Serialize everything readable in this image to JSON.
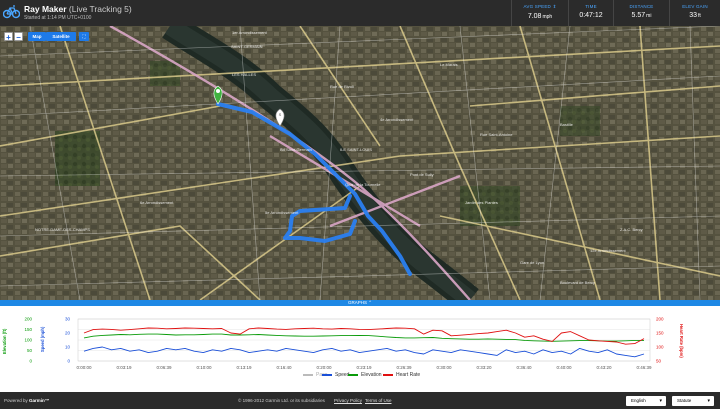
{
  "header": {
    "name": "Ray Maker",
    "subtitle": "(Live Tracking 5)",
    "started": "Started at 1:14 PM UTC+0100",
    "stats": [
      {
        "label": "AVG SPEED",
        "value": "7.08",
        "unit": "mph"
      },
      {
        "label": "TIME",
        "value": "0:47:12",
        "unit": ""
      },
      {
        "label": "DISTANCE",
        "value": "5.57",
        "unit": "mi"
      },
      {
        "label": "ELEV GAIN",
        "value": "33",
        "unit": "ft"
      }
    ]
  },
  "map": {
    "zoom_in": "+",
    "zoom_out": "−",
    "tab_map": "Map",
    "tab_satellite": "Satellite",
    "labels": {
      "l1": "1er Arrondissement",
      "l2": "SAINT-GERMAIN",
      "l3": "LES HALLES",
      "l4": "Pont de Sully",
      "l5": "ILE SAINT-LOUIS",
      "l6": "Bd Saint-Germain",
      "l7": "NOTRE-DAME-DES-CHAMPS",
      "l8": "5e Arrondissement",
      "l9": "Jardin des Plantes",
      "l10": "12e Arrondissement",
      "l11": "Le Marais",
      "l12": "Bastille",
      "l13": "Gare de Lyon",
      "l14": "Boulevard de Bercy",
      "l15": "Z.A.C. Bercy",
      "l16": "Rue Saint-Antoine",
      "l17": "Quai de la Tournelle",
      "l18": "Rue de Rivoli",
      "l19": "4e Arrondissement",
      "l20": "6e Arrondissement"
    }
  },
  "graphs_label": "GRAPHS ⌃",
  "chart_data": {
    "type": "line",
    "x": [
      "0:00:00",
      "0:03:19",
      "0:06:39",
      "0:10:00",
      "0:13:19",
      "0:16:40",
      "0:20:00",
      "0:23:19",
      "0:26:39",
      "0:30:00",
      "0:33:20",
      "0:36:40",
      "0:40:00",
      "0:43:20",
      "0:46:39"
    ],
    "y_left_elevation": {
      "label": "Elevation (ft)",
      "ticks": [
        0,
        50,
        100,
        150,
        200
      ],
      "color": "#0a9b0a"
    },
    "y_left_speed": {
      "label": "Speed (mph)",
      "ticks": [
        0,
        10,
        20,
        30
      ],
      "color": "#1a4fd8"
    },
    "y_right_hr": {
      "label": "Heart Rate (bpm)",
      "ticks": [
        50,
        100,
        150,
        200
      ],
      "color": "#e01010"
    },
    "series": [
      {
        "name": "Speed",
        "color": "#1a4fd8",
        "axis": "speed",
        "values": [
          7,
          9,
          10,
          8,
          9,
          7,
          8,
          6,
          7,
          9,
          8,
          9,
          7,
          6,
          8,
          7,
          9,
          8,
          6,
          7,
          8,
          7,
          9,
          8,
          7,
          6,
          8,
          9,
          7,
          8,
          6,
          7,
          8,
          9,
          7,
          8,
          6,
          5,
          8,
          7,
          6,
          8,
          7,
          6,
          5,
          4,
          8,
          6,
          7,
          5,
          8,
          6,
          7,
          5,
          9,
          7,
          6,
          8,
          5,
          4,
          3,
          5
        ]
      },
      {
        "name": "Elevation",
        "color": "#0a9b0a",
        "axis": "elevation",
        "values": [
          110,
          118,
          122,
          124,
          126,
          125,
          127,
          128,
          128,
          126,
          124,
          125,
          125,
          126,
          128,
          128,
          124,
          124,
          125,
          126,
          124,
          122,
          120,
          119,
          118,
          118,
          119,
          120,
          121,
          121,
          122,
          121,
          118,
          115,
          112,
          110,
          110,
          111,
          112,
          108,
          106,
          105,
          104,
          104,
          105,
          104,
          103,
          102,
          98,
          96,
          95,
          94,
          95,
          96,
          97,
          97,
          96,
          95,
          95,
          96,
          98,
          98
        ]
      },
      {
        "name": "Heart Rate",
        "color": "#e01010",
        "axis": "hr",
        "values": [
          150,
          162,
          164,
          163,
          160,
          162,
          165,
          168,
          167,
          165,
          166,
          168,
          167,
          166,
          165,
          166,
          150,
          146,
          165,
          168,
          166,
          164,
          163,
          165,
          166,
          167,
          165,
          164,
          166,
          165,
          163,
          162,
          164,
          166,
          168,
          167,
          165,
          146,
          160,
          158,
          140,
          142,
          145,
          148,
          150,
          155,
          160,
          150,
          135,
          140,
          128,
          120,
          150,
          155,
          140,
          125,
          122,
          120,
          118,
          110,
          112,
          130
        ]
      },
      {
        "name": "Pace",
        "color": "#aaaaaa",
        "axis": "speed",
        "values": []
      }
    ]
  },
  "legend": [
    "Pace",
    "Speed",
    "Elevation",
    "Heart Rate"
  ],
  "footer": {
    "powered": "Powered by",
    "brand": "Garmin™",
    "copyright": "© 1996-2012 Garmin Ltd. or its subsidiaries",
    "privacy": "Privacy Policy",
    "terms": "Terms of Use",
    "language": "English",
    "units": "Statute"
  },
  "colors": {
    "accent": "#1e88e5",
    "header_bg": "#2b2b2b",
    "route": "#1e7ae8"
  }
}
